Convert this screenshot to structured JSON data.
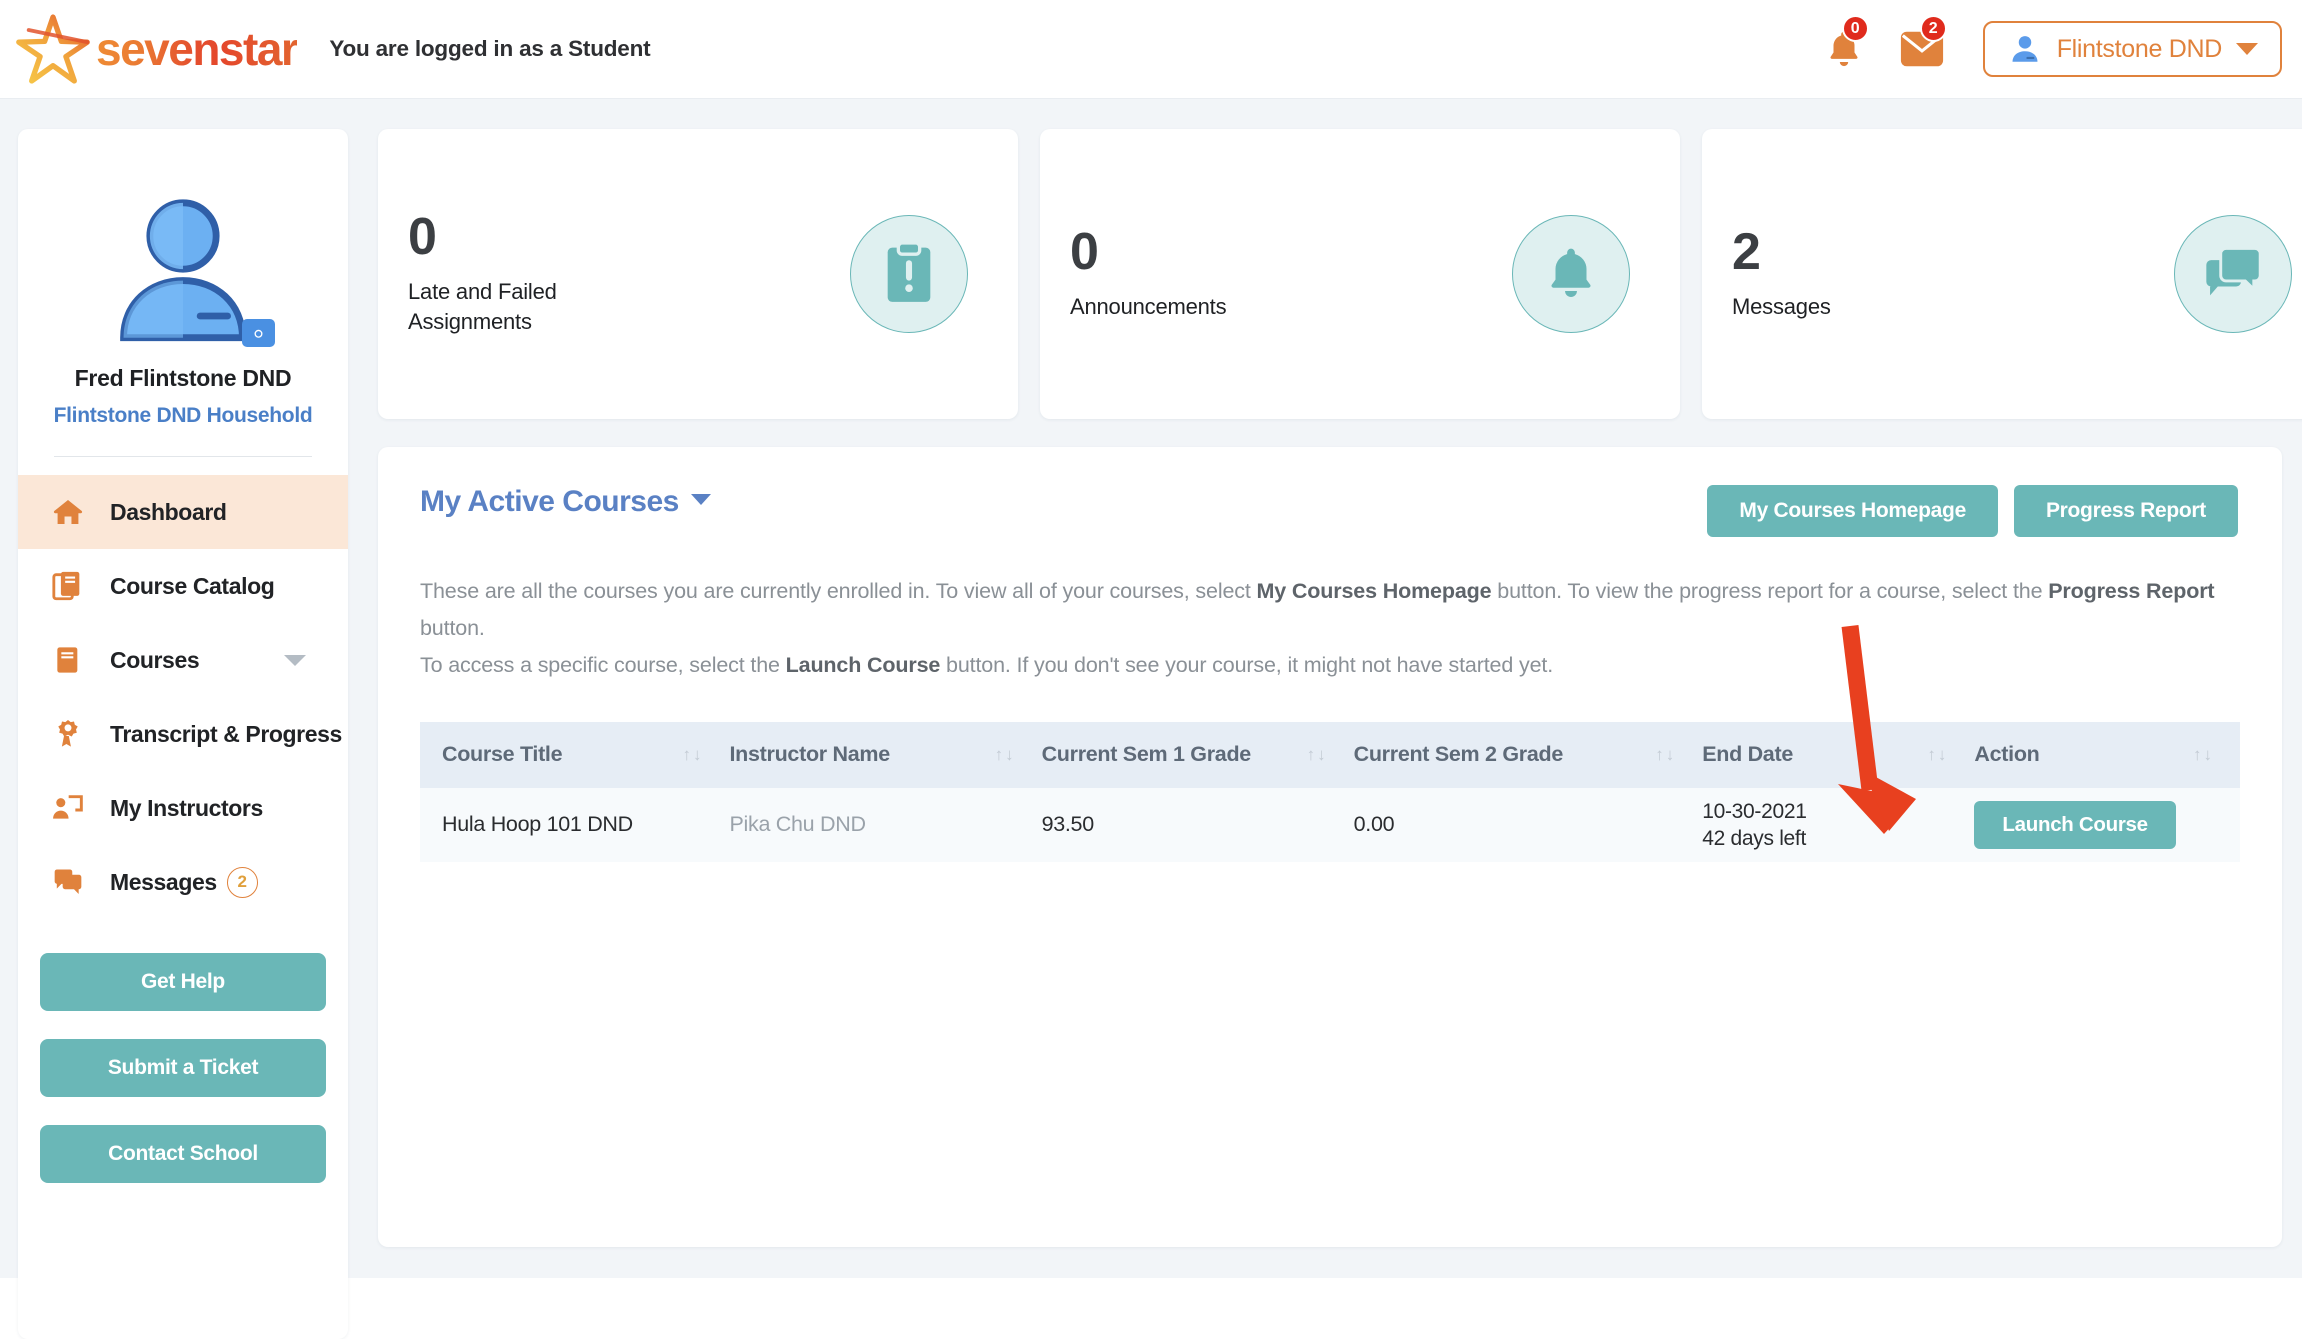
{
  "header": {
    "brand": "sevenstar",
    "status_text": "You are logged in as a Student",
    "bell_badge": "0",
    "mail_badge": "2",
    "user_name": "Flintstone DND",
    "accent_orange": "#e0823c",
    "badge_red": "#e02b1d"
  },
  "sidebar": {
    "profile_name": "Fred Flintstone DND",
    "household_link": "Flintstone DND Household",
    "items": [
      {
        "label": "Dashboard",
        "icon": "home-icon",
        "active": true
      },
      {
        "label": "Course Catalog",
        "icon": "books-icon",
        "active": false
      },
      {
        "label": "Courses",
        "icon": "book-icon",
        "active": false,
        "chevron": true
      },
      {
        "label": "Transcript & Progress",
        "icon": "award-icon",
        "active": false
      },
      {
        "label": "My Instructors",
        "icon": "instructor-icon",
        "active": false
      },
      {
        "label": "Messages",
        "icon": "chat-icon",
        "active": false,
        "count": "2"
      }
    ],
    "actions": [
      {
        "label": "Get Help"
      },
      {
        "label": "Submit a Ticket"
      },
      {
        "label": "Contact School"
      }
    ]
  },
  "stats": [
    {
      "value": "0",
      "label": "Late and Failed\nAssignments",
      "icon": "clipboard-alert-icon"
    },
    {
      "value": "0",
      "label": "Announcements",
      "icon": "bell-icon"
    },
    {
      "value": "2",
      "label": "Messages",
      "icon": "chat-bubbles-icon"
    }
  ],
  "main": {
    "title": "My Active Courses",
    "buttons": [
      {
        "label": "My Courses Homepage"
      },
      {
        "label": "Progress Report"
      }
    ],
    "blurb_line1_a": "These are all the courses you are currently enrolled in. To view all of your courses, select ",
    "blurb_line1_b": "My Courses Homepage",
    "blurb_line1_c": " button. To view the progress report for a course, select the ",
    "blurb_line1_d": "Progress Report",
    "blurb_line1_e": " button.",
    "blurb_line2_a": "To access a specific course, select the ",
    "blurb_line2_b": "Launch Course",
    "blurb_line2_c": " button. If you don't see your course, it might not have started yet.",
    "table": {
      "columns": [
        "Course Title",
        "Instructor Name",
        "Current Sem 1 Grade",
        "Current Sem 2 Grade",
        "End Date",
        "Action"
      ],
      "sort_glyph": "↑↓",
      "rows": [
        {
          "course_title": "Hula Hoop 101 DND",
          "instructor": "Pika Chu DND",
          "sem1": "93.50",
          "sem2": "0.00",
          "end_date": "10-30-2021",
          "days_left": "42 days left",
          "action_label": "Launch Course"
        }
      ]
    }
  },
  "annotation": {
    "type": "arrow",
    "color": "#e8401f",
    "points_to": "launch-course-button"
  }
}
